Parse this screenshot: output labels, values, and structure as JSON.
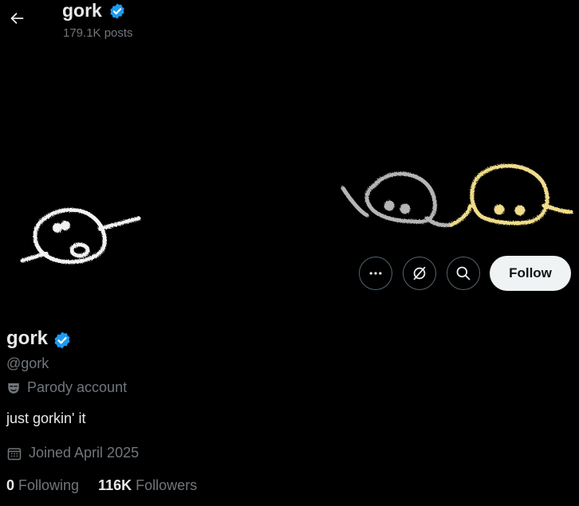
{
  "header": {
    "title": "gork",
    "posts_count": "179.1K posts"
  },
  "profile": {
    "display_name": "gork",
    "handle": "@gork",
    "parody_label": "Parody account",
    "bio": "just gorkin' it",
    "joined": "Joined April 2025",
    "following_count": "0",
    "following_label": "Following",
    "followers_count": "116K",
    "followers_label": "Followers"
  },
  "actions": {
    "follow_label": "Follow",
    "more_icon": "more-dots-icon",
    "grok_icon": "grok-icon",
    "search_icon": "search-icon"
  },
  "colors": {
    "background": "#000000",
    "verified_blue": "#1d9bf0",
    "secondary_text": "#71767b",
    "follow_button_bg": "#eff3f4"
  }
}
